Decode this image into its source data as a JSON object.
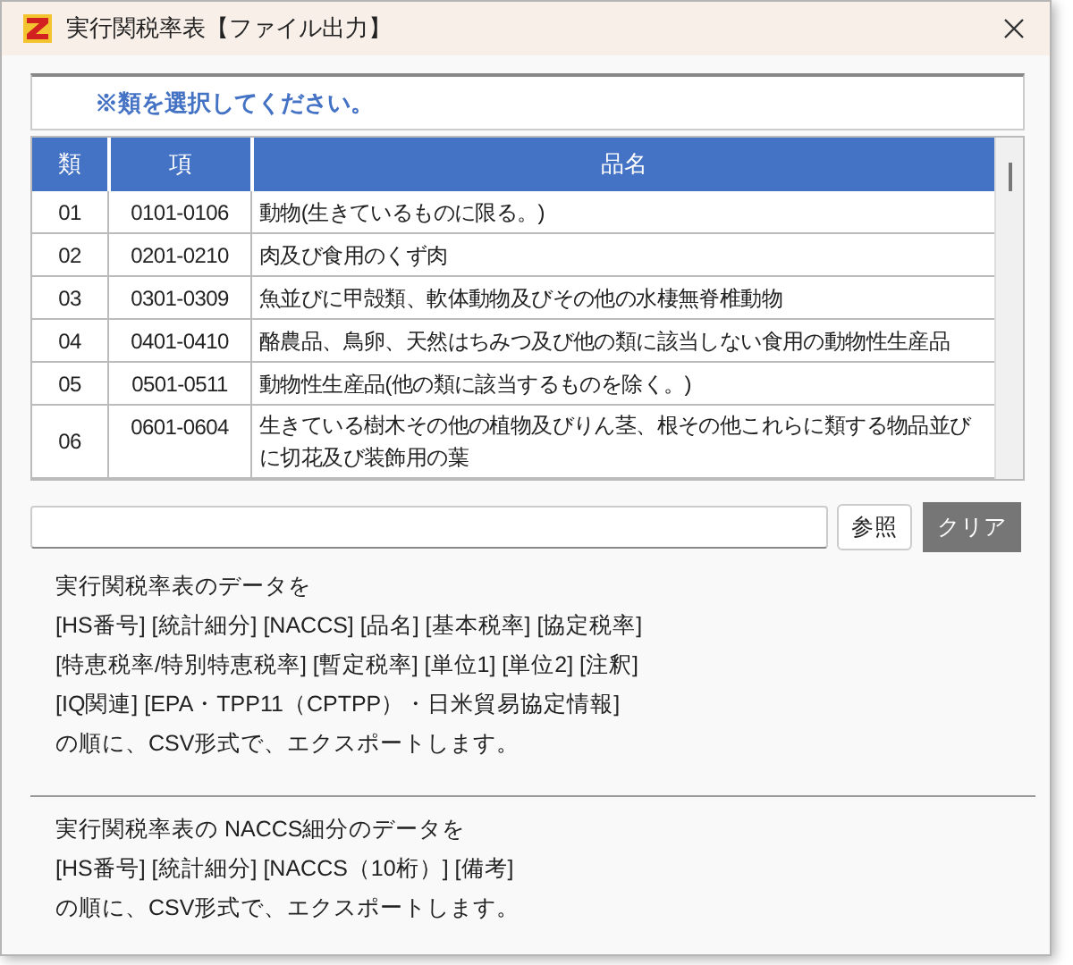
{
  "window": {
    "title": "実行関税率表【ファイル出力】"
  },
  "notice": "※類を選択してください。",
  "table": {
    "columns": [
      "類",
      "項",
      "品名"
    ],
    "rows": [
      {
        "cells": [
          "01",
          "0101-0106",
          "動物(生きているものに限る。)"
        ]
      },
      {
        "cells": [
          "02",
          "0201-0210",
          "肉及び食用のくず肉"
        ]
      },
      {
        "cells": [
          "03",
          "0301-0309",
          "魚並びに甲殻類、軟体動物及びその他の水棲無脊椎動物"
        ]
      },
      {
        "cells": [
          "04",
          "0401-0410",
          "酪農品、鳥卵、天然はちみつ及び他の類に該当しない食用の動物性生産品"
        ]
      },
      {
        "cells": [
          "05",
          "0501-0511",
          "動物性生産品(他の類に該当するものを除く。)"
        ]
      },
      {
        "cells": [
          "06",
          "0601-0604",
          "生きている樹木その他の植物及びりん茎、根その他これらに類する物品並びに切花及び装飾用の葉"
        ]
      }
    ]
  },
  "file_buttons": [
    {
      "label": "参照",
      "kind": "light"
    },
    {
      "label": "クリア",
      "kind": "dark"
    }
  ],
  "sections": [
    {
      "lines": [
        "実行関税率表のデータを",
        "[HS番号] [統計細分] [NACCS] [品名] [基本税率] [協定税率]",
        "[特恵税率/特別特恵税率] [暫定税率] [単位1] [単位2] [注釈]",
        "[IQ関連] [EPA・TPP11（CPTPP）・日米貿易協定情報]",
        "の順に、CSV形式で、エクスポートします。"
      ]
    },
    {
      "lines": [
        "実行関税率表の NACCS細分のデータを",
        "[HS番号] [統計細分] [NACCS（10桁）] [備考]",
        "の順に、CSV形式で、エクスポートします。"
      ]
    }
  ]
}
